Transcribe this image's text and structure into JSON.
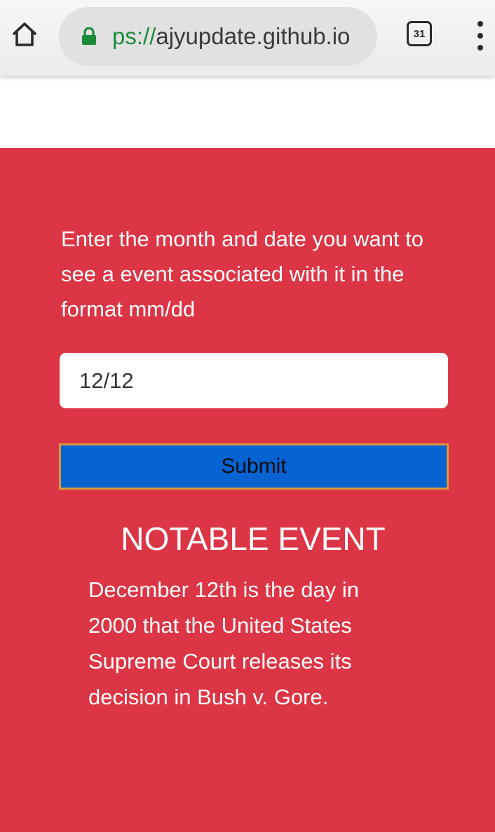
{
  "browser": {
    "url_scheme": "ps://",
    "url_host": "ajyupdate.github.io",
    "tab_count": "31",
    "icons": {
      "home": "home-icon",
      "lock": "lock-icon",
      "tabs": "tab-count-icon",
      "menu": "more-vert-icon"
    },
    "colors": {
      "lock": "#1b8a3a",
      "url_bar": "#e1e1e1"
    }
  },
  "page": {
    "instructions": "Enter the month and date you want to see a event associated with it in the format mm/dd",
    "date_input": {
      "value": "12/12",
      "placeholder": ""
    },
    "submit_label": "Submit",
    "event_heading": "NOTABLE EVENT",
    "event_text": "December 12th is the day in 2000 that the United States Supreme Court releases its decision in Bush v. Gore.",
    "colors": {
      "background": "#dc3545",
      "button": "#0762d2",
      "button_border": "#d89a3a",
      "text": "#ffffff"
    }
  }
}
